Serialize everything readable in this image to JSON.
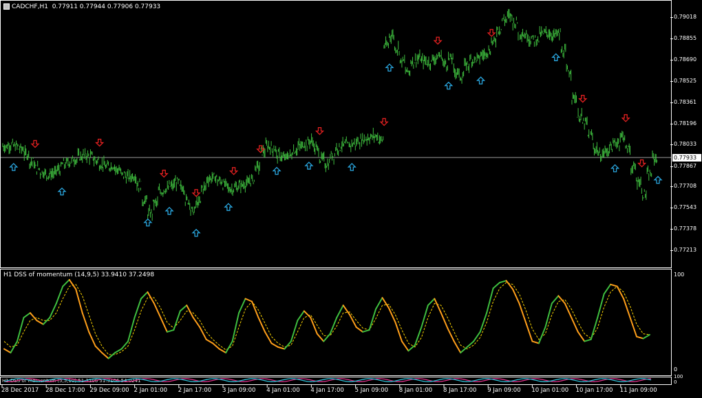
{
  "chart_info": {
    "symbol_label": "CADCHF,H1",
    "ohlc": "0.77911 0.77944 0.77906 0.77933",
    "current_price": "0.77933",
    "indicator_label": "H1 DSS of momentum (14,9,5) 33.9410 37.2498",
    "mini_indicator_label": "H1 DSS of momentum (5,5,10) 51.3106 51.3106 54.0241"
  },
  "colors": {
    "background": "#000000",
    "bar": "#3fbf3f",
    "arrow_up": "#2aa7e0",
    "arrow_down": "#e32020",
    "dss_up": "#3fbf3f",
    "dss_down": "#ff9f1a",
    "signal": "#ffd700"
  },
  "chart_data": {
    "type": "line",
    "price_axis_ticks": [
      "0.79018",
      "0.78855",
      "0.78690",
      "0.78525",
      "0.78361",
      "0.78196",
      "0.78033",
      "0.77933",
      "0.77867",
      "0.77708",
      "0.77543",
      "0.77378",
      "0.77213"
    ],
    "price_range": [
      0.7713,
      0.791
    ],
    "osc_axis_ticks": [
      "100",
      "0"
    ],
    "mini_axis_ticks": [
      "100",
      "0"
    ],
    "time_axis_labels": [
      "28 Dec 2017",
      "28 Dec 17:00",
      "29 Dec 09:00",
      "2 Jan 01:00",
      "2 Jan 17:00",
      "3 Jan 09:00",
      "4 Jan 01:00",
      "4 Jan 17:00",
      "5 Jan 09:00",
      "8 Jan 01:00",
      "8 Jan 17:00",
      "9 Jan 09:00",
      "10 Jan 01:00",
      "10 Jan 17:00",
      "11 Jan 09:00"
    ],
    "price_series": [
      0.7802,
      0.7803,
      0.7802,
      0.78,
      0.7796,
      0.779,
      0.7785,
      0.7782,
      0.778,
      0.7781,
      0.7784,
      0.7788,
      0.779,
      0.7792,
      0.7794,
      0.7795,
      0.7794,
      0.7791,
      0.7788,
      0.7786,
      0.7787,
      0.7784,
      0.778,
      0.7778,
      0.7779,
      0.7772,
      0.776,
      0.775,
      0.7758,
      0.7767,
      0.7769,
      0.7771,
      0.7774,
      0.777,
      0.776,
      0.7752,
      0.7758,
      0.777,
      0.7777,
      0.7778,
      0.7775,
      0.7772,
      0.7769,
      0.777,
      0.7772,
      0.7773,
      0.7776,
      0.7786,
      0.7798,
      0.7802,
      0.78,
      0.7795,
      0.7793,
      0.7795,
      0.7799,
      0.7802,
      0.7804,
      0.7806,
      0.78,
      0.7792,
      0.7788,
      0.7795,
      0.7801,
      0.7803,
      0.7803,
      0.7804,
      0.7806,
      0.7808,
      0.7809,
      0.781,
      0.7807,
      0.788,
      0.7888,
      0.7878,
      0.7868,
      0.786,
      0.7868,
      0.787,
      0.7868,
      0.7867,
      0.787,
      0.7872,
      0.7866,
      0.787,
      0.786,
      0.7856,
      0.7865,
      0.7869,
      0.787,
      0.7873,
      0.7876,
      0.7883,
      0.7893,
      0.79,
      0.7903,
      0.7898,
      0.789,
      0.7888,
      0.7885,
      0.7885,
      0.7889,
      0.789,
      0.7888,
      0.7889,
      0.7875,
      0.786,
      0.784,
      0.7825,
      0.782,
      0.781,
      0.78,
      0.7795,
      0.7798,
      0.7802,
      0.7805,
      0.781,
      0.78,
      0.7785,
      0.7775,
      0.7765,
      0.778,
      0.7793
    ],
    "dss_series": [
      22,
      18,
      30,
      55,
      60,
      52,
      48,
      55,
      70,
      88,
      95,
      85,
      60,
      40,
      25,
      18,
      12,
      18,
      22,
      30,
      55,
      75,
      82,
      70,
      55,
      40,
      42,
      62,
      68,
      55,
      45,
      32,
      28,
      22,
      18,
      30,
      60,
      75,
      72,
      55,
      40,
      28,
      24,
      22,
      30,
      52,
      62,
      55,
      38,
      30,
      38,
      55,
      68,
      58,
      45,
      40,
      42,
      64,
      76,
      65,
      50,
      30,
      20,
      26,
      45,
      68,
      75,
      60,
      44,
      30,
      18,
      24,
      30,
      40,
      60,
      86,
      92,
      94,
      85,
      70,
      50,
      30,
      28,
      45,
      70,
      78,
      70,
      55,
      40,
      30,
      32,
      55,
      80,
      90,
      88,
      75,
      55,
      35,
      33,
      37
    ],
    "signal_series": [
      30,
      24,
      26,
      40,
      52,
      55,
      52,
      52,
      60,
      75,
      88,
      90,
      78,
      58,
      38,
      25,
      16,
      16,
      19,
      25,
      42,
      62,
      76,
      76,
      65,
      50,
      44,
      52,
      62,
      60,
      52,
      40,
      32,
      26,
      21,
      25,
      45,
      64,
      72,
      63,
      49,
      35,
      28,
      24,
      26,
      40,
      55,
      58,
      47,
      36,
      36,
      46,
      60,
      61,
      52,
      44,
      42,
      54,
      68,
      69,
      58,
      42,
      28,
      24,
      34,
      55,
      70,
      68,
      55,
      40,
      26,
      22,
      26,
      34,
      50,
      72,
      86,
      92,
      90,
      80,
      63,
      43,
      32,
      38,
      58,
      72,
      74,
      64,
      50,
      38,
      33,
      44,
      66,
      82,
      88,
      82,
      67,
      48,
      38,
      37
    ],
    "up_arrow_indices": [
      1,
      10,
      26,
      30,
      35,
      41,
      50,
      56,
      64,
      71,
      82,
      88,
      102,
      113,
      121
    ],
    "down_arrow_indices": [
      5,
      17,
      29,
      35,
      42,
      47,
      58,
      70,
      80,
      90,
      107,
      115,
      118
    ]
  }
}
